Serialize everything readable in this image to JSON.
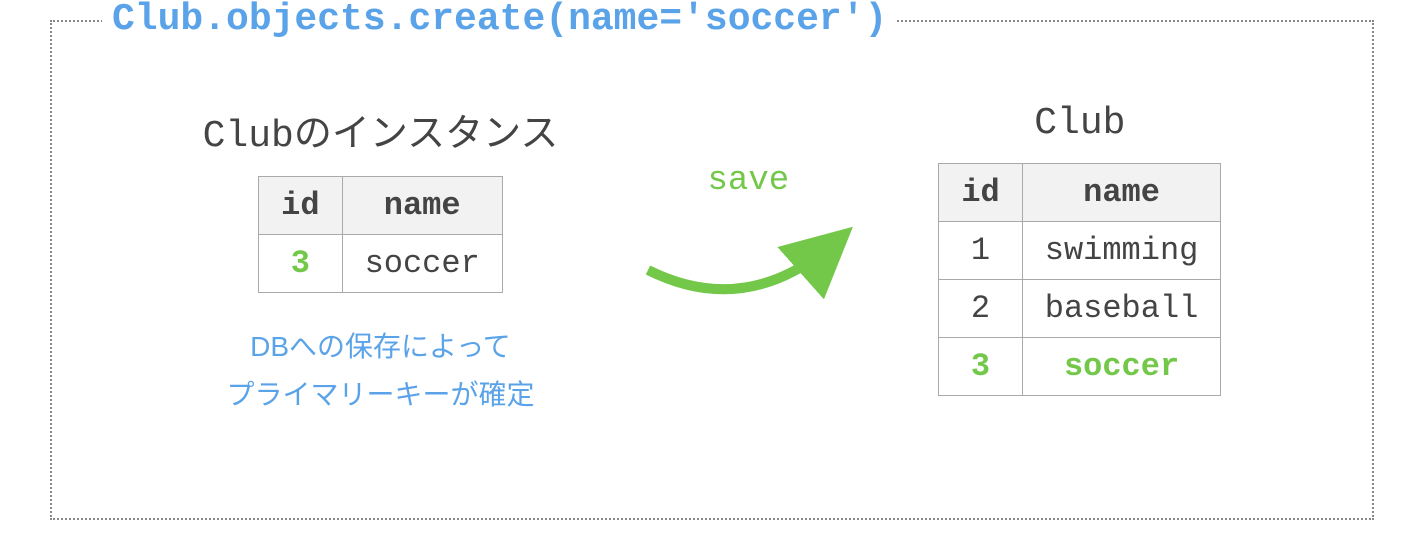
{
  "code_title": "Club.objects.create(name='soccer')",
  "left": {
    "title": "Clubのインスタンス",
    "headers": {
      "id": "id",
      "name": "name"
    },
    "row": {
      "id": "3",
      "name": "soccer"
    },
    "caption_line1": "DBへの保存によって",
    "caption_line2": "プライマリーキーが確定"
  },
  "arrow_label": "save",
  "right": {
    "title": "Club",
    "headers": {
      "id": "id",
      "name": "name"
    },
    "rows": [
      {
        "id": "1",
        "name": "swimming"
      },
      {
        "id": "2",
        "name": "baseball"
      },
      {
        "id": "3",
        "name": "soccer"
      }
    ]
  },
  "colors": {
    "blue": "#5ba3e8",
    "green": "#73c84a"
  }
}
